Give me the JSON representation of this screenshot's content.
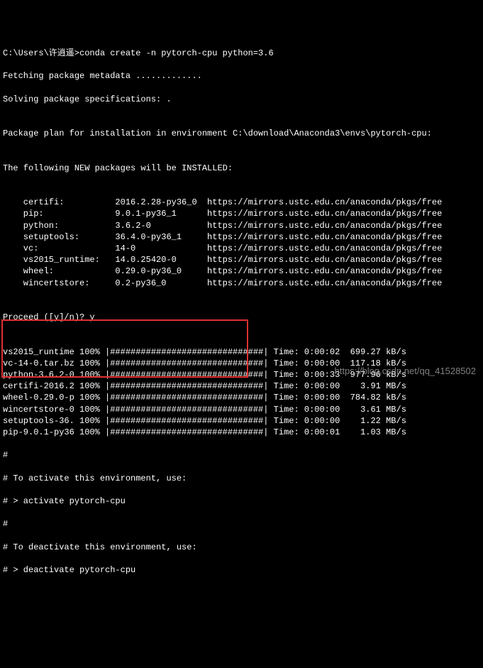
{
  "prompt_line": "C:\\Users\\许逍遥>conda create -n pytorch-cpu python=3.6",
  "fetch_line": "Fetching package metadata .............",
  "solve_line": "Solving package specifications: .",
  "blank": "",
  "plan_line": "Package plan for installation in environment C:\\download\\Anaconda3\\envs\\pytorch-cpu:",
  "new_packages_line": "The following NEW packages will be INSTALLED:",
  "packages": [
    {
      "name": "certifi:",
      "ver": "2016.2.28-py36_0",
      "url": "https://mirrors.ustc.edu.cn/anaconda/pkgs/free"
    },
    {
      "name": "pip:",
      "ver": "9.0.1-py36_1",
      "url": "https://mirrors.ustc.edu.cn/anaconda/pkgs/free"
    },
    {
      "name": "python:",
      "ver": "3.6.2-0",
      "url": "https://mirrors.ustc.edu.cn/anaconda/pkgs/free"
    },
    {
      "name": "setuptools:",
      "ver": "36.4.0-py36_1",
      "url": "https://mirrors.ustc.edu.cn/anaconda/pkgs/free"
    },
    {
      "name": "vc:",
      "ver": "14-0",
      "url": "https://mirrors.ustc.edu.cn/anaconda/pkgs/free"
    },
    {
      "name": "vs2015_runtime:",
      "ver": "14.0.25420-0",
      "url": "https://mirrors.ustc.edu.cn/anaconda/pkgs/free"
    },
    {
      "name": "wheel:",
      "ver": "0.29.0-py36_0",
      "url": "https://mirrors.ustc.edu.cn/anaconda/pkgs/free"
    },
    {
      "name": "wincertstore:",
      "ver": "0.2-py36_0",
      "url": "https://mirrors.ustc.edu.cn/anaconda/pkgs/free"
    }
  ],
  "proceed_line": "Proceed ([y]/n)? y",
  "downloads": [
    {
      "name": "vs2015_runtime",
      "pct": "100%",
      "bar": "|##############################|",
      "time": "Time: 0:00:02",
      "rate": "699.27 kB/s"
    },
    {
      "name": "vc-14-0.tar.bz",
      "pct": "100%",
      "bar": "|##############################|",
      "time": "Time: 0:00:00",
      "rate": "117.18 kB/s"
    },
    {
      "name": "python-3.6.2-0",
      "pct": "100%",
      "bar": "|##############################|",
      "time": "Time: 0:00:33",
      "rate": "977.96 kB/s"
    },
    {
      "name": "certifi-2016.2",
      "pct": "100%",
      "bar": "|##############################|",
      "time": "Time: 0:00:00",
      "rate": "  3.91 MB/s"
    },
    {
      "name": "wheel-0.29.0-p",
      "pct": "100%",
      "bar": "|##############################|",
      "time": "Time: 0:00:00",
      "rate": "784.82 kB/s"
    },
    {
      "name": "wincertstore-0",
      "pct": "100%",
      "bar": "|##############################|",
      "time": "Time: 0:00:00",
      "rate": "  3.61 MB/s"
    },
    {
      "name": "setuptools-36.",
      "pct": "100%",
      "bar": "|##############################|",
      "time": "Time: 0:00:00",
      "rate": "  1.22 MB/s"
    },
    {
      "name": "pip-9.0.1-py36",
      "pct": "100%",
      "bar": "|##############################|",
      "time": "Time: 0:00:01",
      "rate": "  1.03 MB/s"
    }
  ],
  "footer": {
    "h1": "#",
    "h2": "# To activate this environment, use:",
    "h3": "# > activate pytorch-cpu",
    "h4": "#",
    "h5": "# To deactivate this environment, use:",
    "h6": "# > deactivate pytorch-cpu"
  },
  "watermark": "https://blog.csdn.net/qq_41528502"
}
